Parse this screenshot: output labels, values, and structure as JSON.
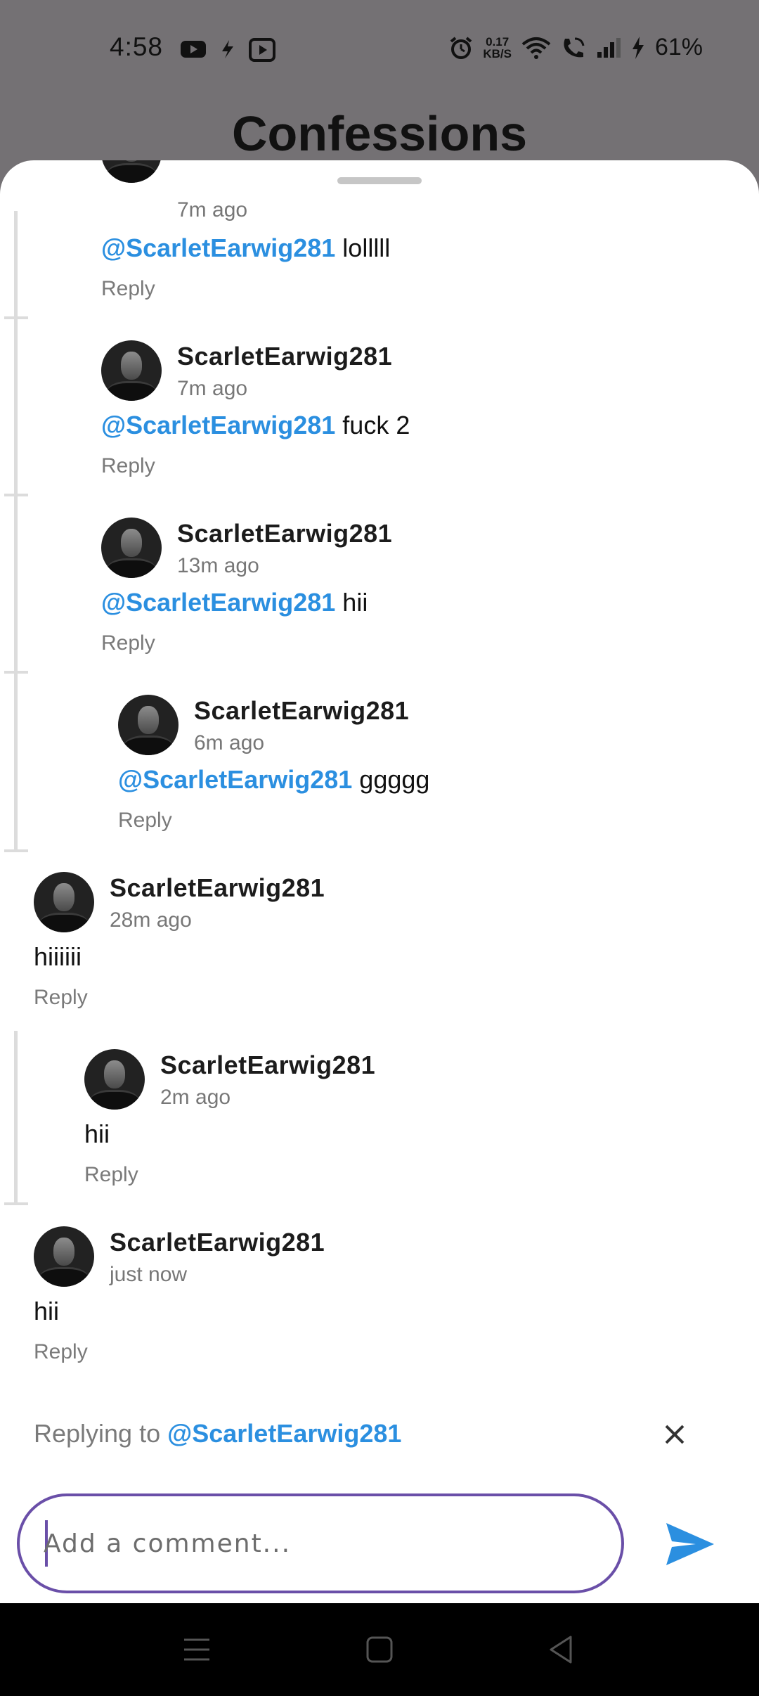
{
  "status_bar": {
    "time": "4:58",
    "net_speed_value": "0.17",
    "net_speed_unit": "KB/S",
    "battery": "61%",
    "left_icons": [
      "youtube-icon",
      "bolt-icon",
      "tv-icon"
    ],
    "right_icons": [
      "alarm-icon",
      "wifi-icon",
      "wifi-call-icon",
      "signal-icon",
      "charging-icon"
    ]
  },
  "background": {
    "title": "Confessions"
  },
  "comments": [
    {
      "username": "",
      "time": "7m ago",
      "mention": "@ScarletEarwig281",
      "text": "lolllll",
      "reply": "Reply"
    },
    {
      "username": "ScarletEarwig281",
      "time": "7m ago",
      "mention": "@ScarletEarwig281",
      "text": "fuck 2",
      "reply": "Reply"
    },
    {
      "username": "ScarletEarwig281",
      "time": "13m ago",
      "mention": "@ScarletEarwig281",
      "text": "hii",
      "reply": "Reply"
    },
    {
      "username": "ScarletEarwig281",
      "time": "6m ago",
      "mention": "@ScarletEarwig281",
      "text": "ggggg",
      "reply": "Reply"
    },
    {
      "username": "ScarletEarwig281",
      "time": "28m ago",
      "mention": "",
      "text": "hiiiiii",
      "reply": "Reply"
    },
    {
      "username": "ScarletEarwig281",
      "time": "2m ago",
      "mention": "",
      "text": "hii",
      "reply": "Reply"
    },
    {
      "username": "ScarletEarwig281",
      "time": "just now",
      "mention": "",
      "text": "hii",
      "reply": "Reply"
    }
  ],
  "reply_bar": {
    "prefix": "Replying to",
    "mention": "@ScarletEarwig281"
  },
  "composer": {
    "placeholder": "Add a comment...",
    "value": ""
  },
  "colors": {
    "mention": "#2b8fe0",
    "accent": "#6a4fa8",
    "send": "#2b8fe0"
  }
}
